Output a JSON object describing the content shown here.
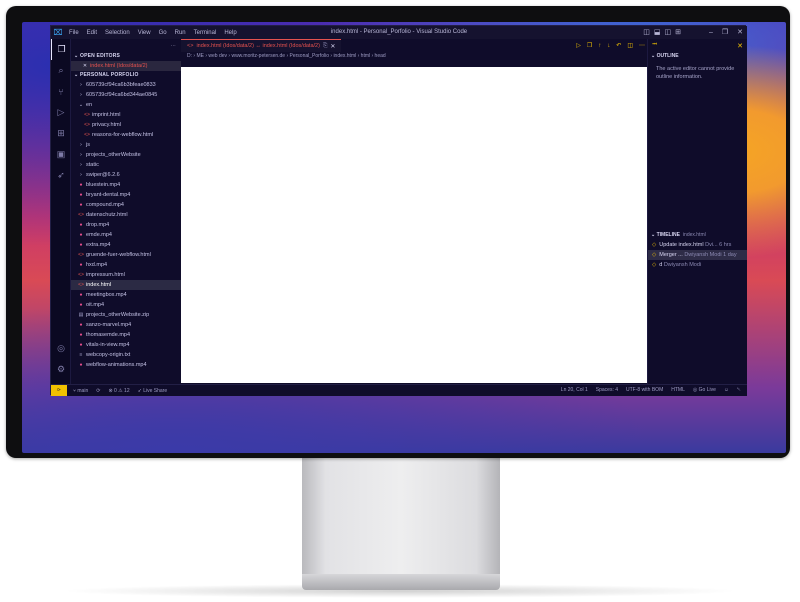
{
  "window": {
    "title": "index.html - Personal_Porfolio - Visual Studio Code",
    "menu": [
      "File",
      "Edit",
      "Selection",
      "View",
      "Go",
      "Run",
      "Terminal",
      "Help"
    ]
  },
  "sidebar": {
    "open_editors": "OPEN EDITORS",
    "open_editor_item": "index.html (Idos/data/2)",
    "project": "PERSONAL PORFOLIO",
    "items": [
      {
        "label": "605739cf94ca6b3bfeae0833",
        "kind": "folder",
        "indent": 0
      },
      {
        "label": "605739cf94ca6bd344ae0845",
        "kind": "folder",
        "indent": 0
      },
      {
        "label": "en",
        "kind": "folder-open",
        "indent": 0
      },
      {
        "label": "imprint.html",
        "kind": "html",
        "indent": 1
      },
      {
        "label": "privacy.html",
        "kind": "html",
        "indent": 1
      },
      {
        "label": "reasons-for-webflow.html",
        "kind": "html",
        "indent": 1
      },
      {
        "label": "js",
        "kind": "folder",
        "indent": 0
      },
      {
        "label": "projects_otherWebsite",
        "kind": "folder",
        "indent": 0
      },
      {
        "label": "static",
        "kind": "folder",
        "indent": 0
      },
      {
        "label": "swiper@6.2.6",
        "kind": "folder",
        "indent": 0
      },
      {
        "label": "bluestein.mp4",
        "kind": "media",
        "indent": 0
      },
      {
        "label": "bryant-dental.mp4",
        "kind": "media",
        "indent": 0
      },
      {
        "label": "compound.mp4",
        "kind": "media",
        "indent": 0
      },
      {
        "label": "datenschutz.html",
        "kind": "html",
        "indent": 0
      },
      {
        "label": "drop.mp4",
        "kind": "media",
        "indent": 0
      },
      {
        "label": "emde.mp4",
        "kind": "media",
        "indent": 0
      },
      {
        "label": "extra.mp4",
        "kind": "media",
        "indent": 0
      },
      {
        "label": "gruende-fuer-webflow.html",
        "kind": "html",
        "indent": 0
      },
      {
        "label": "hxd.mp4",
        "kind": "media",
        "indent": 0
      },
      {
        "label": "impressum.html",
        "kind": "html",
        "indent": 0
      },
      {
        "label": "index.html",
        "kind": "html",
        "indent": 0,
        "selected": true
      },
      {
        "label": "meetingbox.mp4",
        "kind": "media",
        "indent": 0
      },
      {
        "label": "oit.mp4",
        "kind": "media",
        "indent": 0
      },
      {
        "label": "projects_otherWebsite.zip",
        "kind": "zip",
        "indent": 0
      },
      {
        "label": "sanzo-marvel.mp4",
        "kind": "media",
        "indent": 0
      },
      {
        "label": "thomasemde.mp4",
        "kind": "media",
        "indent": 0
      },
      {
        "label": "vitals-in-view.mp4",
        "kind": "media",
        "indent": 0
      },
      {
        "label": "webcopy-origin.txt",
        "kind": "txt",
        "indent": 0
      },
      {
        "label": "webflow-animations.mp4",
        "kind": "media",
        "indent": 0
      }
    ]
  },
  "editor": {
    "tab_label": "index.html (Idos/data/2) ↔ index.html (Idos/data/2)",
    "breadcrumb": "D: › ME › web dev › www.moritz-petersen.de › Personal_Porfolio › index.html › html › head"
  },
  "outline": {
    "title": "OUTLINE",
    "message": "The active editor cannot provide outline information."
  },
  "timeline": {
    "title": "TIMELINE",
    "file": "index.html",
    "entries": [
      {
        "text": "Update index.html",
        "meta": "Dvi... 6 hrs"
      },
      {
        "text": "Merger ...",
        "meta": "Dwiyansh Modi 1 day",
        "selected": true
      },
      {
        "text": "d",
        "meta": "Dwiyansh Modi"
      }
    ]
  },
  "status": {
    "branch": "main",
    "errors": "⊗ 0 ⚠ 12",
    "liveshare": "Live Share",
    "position": "Ln 20, Col 1",
    "spaces": "Spaces: 4",
    "encoding": "UTF-8 with BOM",
    "language": "HTML",
    "golive": "Go Live"
  },
  "colors": {
    "accent": "#f2c200",
    "bg": "#0f0c2a",
    "error": "#e5524f"
  }
}
